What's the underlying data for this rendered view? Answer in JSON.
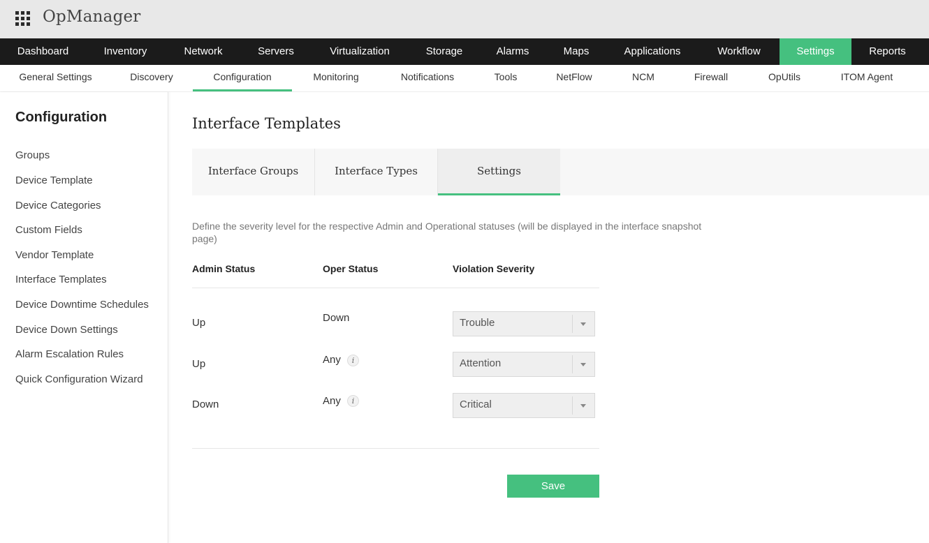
{
  "app": {
    "title": "OpManager",
    "grid_icon": "apps-grid-icon",
    "accent_color": "#45c07f"
  },
  "main_nav": {
    "items": [
      {
        "label": "Dashboard"
      },
      {
        "label": "Inventory"
      },
      {
        "label": "Network"
      },
      {
        "label": "Servers"
      },
      {
        "label": "Virtualization"
      },
      {
        "label": "Storage"
      },
      {
        "label": "Alarms"
      },
      {
        "label": "Maps"
      },
      {
        "label": "Applications"
      },
      {
        "label": "Workflow"
      },
      {
        "label": "Settings",
        "active": true
      },
      {
        "label": "Reports"
      }
    ]
  },
  "sub_nav": {
    "items": [
      {
        "label": "General Settings"
      },
      {
        "label": "Discovery"
      },
      {
        "label": "Configuration",
        "active": true
      },
      {
        "label": "Monitoring"
      },
      {
        "label": "Notifications"
      },
      {
        "label": "Tools"
      },
      {
        "label": "NetFlow"
      },
      {
        "label": "NCM"
      },
      {
        "label": "Firewall"
      },
      {
        "label": "OpUtils"
      },
      {
        "label": "ITOM Agent"
      }
    ]
  },
  "sidebar": {
    "title": "Configuration",
    "items": [
      {
        "label": "Groups"
      },
      {
        "label": "Device Template"
      },
      {
        "label": "Device Categories"
      },
      {
        "label": "Custom Fields"
      },
      {
        "label": "Vendor Template"
      },
      {
        "label": "Interface Templates"
      },
      {
        "label": "Device Downtime Schedules"
      },
      {
        "label": "Device Down Settings"
      },
      {
        "label": "Alarm Escalation Rules"
      },
      {
        "label": "Quick Configuration Wizard"
      }
    ]
  },
  "main": {
    "title": "Interface Templates",
    "tabs": [
      {
        "label": "Interface Groups"
      },
      {
        "label": "Interface Types"
      },
      {
        "label": "Settings",
        "active": true
      }
    ],
    "description": "Define the severity level for the respective Admin and Operational statuses (will be displayed in the interface snapshot page)",
    "columns": {
      "admin": "Admin Status",
      "oper": "Oper Status",
      "severity": "Violation Severity"
    },
    "rows": [
      {
        "admin": "Up",
        "oper": "Down",
        "has_info": false,
        "severity": "Trouble"
      },
      {
        "admin": "Up",
        "oper": "Any",
        "has_info": true,
        "severity": "Attention"
      },
      {
        "admin": "Down",
        "oper": "Any",
        "has_info": true,
        "severity": "Critical"
      }
    ],
    "info_glyph": "i",
    "save_label": "Save"
  }
}
